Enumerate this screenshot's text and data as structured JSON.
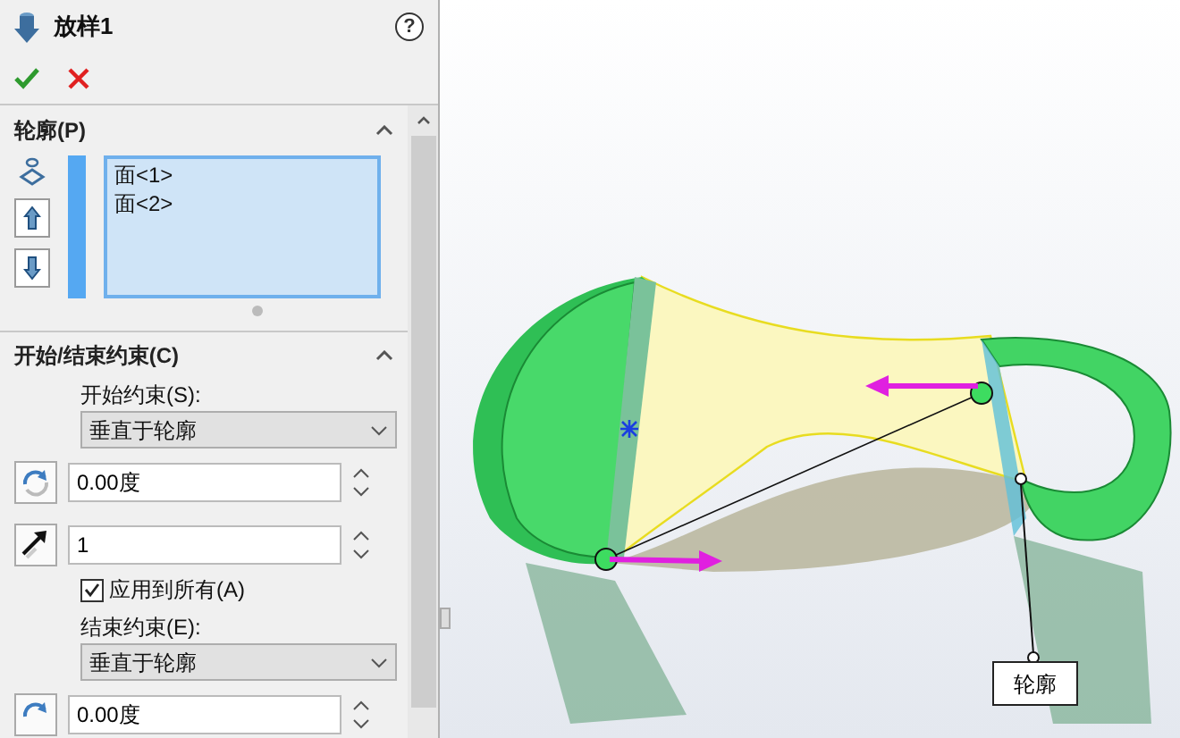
{
  "feature": {
    "title": "放样1",
    "help": "?"
  },
  "profiles": {
    "title": "轮廓(P)",
    "expanded": true,
    "items": [
      {
        "label": "面<1>"
      },
      {
        "label": "面<2>"
      }
    ]
  },
  "constraints": {
    "title": "开始/结束约束(C)",
    "expanded": true,
    "start_label": "开始约束(S):",
    "start_select": "垂直于轮廓",
    "start_angle": "0.00度",
    "start_length": "1",
    "apply_all": {
      "label": "应用到所有(A)",
      "checked": true
    },
    "end_label": "结束约束(E):",
    "end_select": "垂直于轮廓",
    "end_angle": "0.00度"
  },
  "viewport": {
    "callout": "轮廓"
  }
}
